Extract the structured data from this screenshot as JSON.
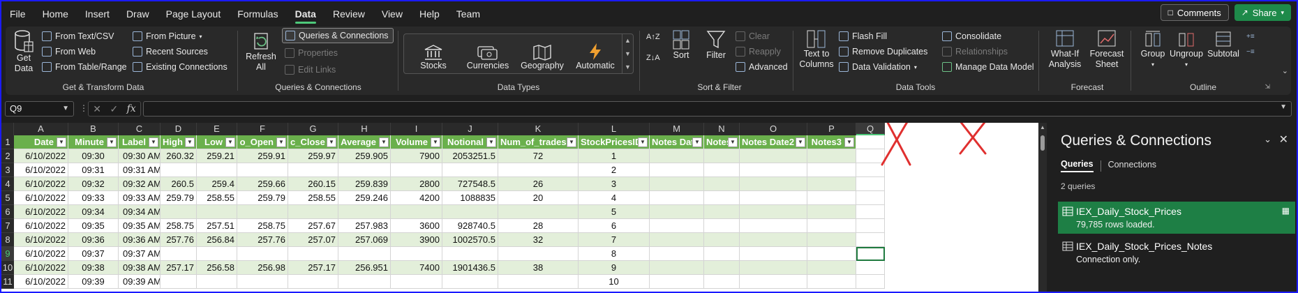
{
  "tabs": [
    "File",
    "Home",
    "Insert",
    "Draw",
    "Page Layout",
    "Formulas",
    "Data",
    "Review",
    "View",
    "Help",
    "Team"
  ],
  "active_tab": "Data",
  "top_buttons": {
    "comments": "Comments",
    "share": "Share"
  },
  "ribbon": {
    "get_transform": {
      "label": "Get & Transform Data",
      "get_data": "Get Data",
      "from_text_csv": "From Text/CSV",
      "from_web": "From Web",
      "from_table_range": "From Table/Range",
      "from_picture": "From Picture",
      "recent_sources": "Recent Sources",
      "existing_connections": "Existing Connections"
    },
    "queries_connections": {
      "label": "Queries & Connections",
      "refresh_all": "Refresh All",
      "queries_connections_btn": "Queries & Connections",
      "properties": "Properties",
      "edit_links": "Edit Links"
    },
    "data_types": {
      "label": "Data Types",
      "items": [
        "Stocks",
        "Currencies",
        "Geography",
        "Automatic"
      ]
    },
    "sort_filter": {
      "label": "Sort & Filter",
      "sort": "Sort",
      "filter": "Filter",
      "clear": "Clear",
      "reapply": "Reapply",
      "advanced": "Advanced"
    },
    "data_tools": {
      "label": "Data Tools",
      "text_to_columns": "Text to Columns",
      "flash_fill": "Flash Fill",
      "remove_duplicates": "Remove Duplicates",
      "data_validation": "Data Validation",
      "consolidate": "Consolidate",
      "relationships": "Relationships",
      "manage_data_model": "Manage Data Model"
    },
    "forecast": {
      "label": "Forecast",
      "what_if": "What-If Analysis",
      "forecast_sheet": "Forecast Sheet"
    },
    "outline": {
      "label": "Outline",
      "group": "Group",
      "ungroup": "Ungroup",
      "subtotal": "Subtotal"
    }
  },
  "formula_bar": {
    "name_box": "Q9",
    "formula": ""
  },
  "columns": [
    "A",
    "B",
    "C",
    "D",
    "E",
    "F",
    "G",
    "H",
    "I",
    "J",
    "K",
    "L",
    "M",
    "N",
    "O",
    "P",
    "Q"
  ],
  "selected_column": "Q",
  "selected_row": "9",
  "header_row": [
    "Date",
    "Minute",
    "Label",
    "High",
    "Low",
    "o_Open",
    "c_Close",
    "Average",
    "Volume",
    "Notional",
    "Num_of_trades",
    "StockPricesID",
    "Notes Date",
    "Notes",
    "Notes Date2",
    "Notes3"
  ],
  "rows": [
    [
      "6/10/2022",
      "09:30",
      "09:30 AM",
      "260.32",
      "259.21",
      "259.91",
      "259.97",
      "259.905",
      "7900",
      "2053251.5",
      "72",
      "1",
      "",
      "",
      "",
      ""
    ],
    [
      "6/10/2022",
      "09:31",
      "09:31 AM",
      "",
      "",
      "",
      "",
      "",
      "",
      "",
      "",
      "2",
      "",
      "",
      "",
      ""
    ],
    [
      "6/10/2022",
      "09:32",
      "09:32 AM",
      "260.5",
      "259.4",
      "259.66",
      "260.15",
      "259.839",
      "2800",
      "727548.5",
      "26",
      "3",
      "",
      "",
      "",
      ""
    ],
    [
      "6/10/2022",
      "09:33",
      "09:33 AM",
      "259.79",
      "258.55",
      "259.79",
      "258.55",
      "259.246",
      "4200",
      "1088835",
      "20",
      "4",
      "",
      "",
      "",
      ""
    ],
    [
      "6/10/2022",
      "09:34",
      "09:34 AM",
      "",
      "",
      "",
      "",
      "",
      "",
      "",
      "",
      "5",
      "",
      "",
      "",
      ""
    ],
    [
      "6/10/2022",
      "09:35",
      "09:35 AM",
      "258.75",
      "257.51",
      "258.75",
      "257.67",
      "257.983",
      "3600",
      "928740.5",
      "28",
      "6",
      "",
      "",
      "",
      ""
    ],
    [
      "6/10/2022",
      "09:36",
      "09:36 AM",
      "257.76",
      "256.84",
      "257.76",
      "257.07",
      "257.069",
      "3900",
      "1002570.5",
      "32",
      "7",
      "",
      "",
      "",
      ""
    ],
    [
      "6/10/2022",
      "09:37",
      "09:37 AM",
      "",
      "",
      "",
      "",
      "",
      "",
      "",
      "",
      "8",
      "",
      "",
      "",
      ""
    ],
    [
      "6/10/2022",
      "09:38",
      "09:38 AM",
      "257.17",
      "256.58",
      "256.98",
      "257.17",
      "256.951",
      "7400",
      "1901436.5",
      "38",
      "9",
      "",
      "",
      "",
      ""
    ],
    [
      "6/10/2022",
      "09:39",
      "09:39 AM",
      "",
      "",
      "",
      "",
      "",
      "",
      "",
      "",
      "10",
      "",
      "",
      "",
      ""
    ]
  ],
  "row_numbers": [
    "1",
    "2",
    "3",
    "4",
    "5",
    "6",
    "7",
    "8",
    "9",
    "10",
    "11"
  ],
  "pane": {
    "title": "Queries & Connections",
    "tabs": [
      "Queries",
      "Connections"
    ],
    "count": "2 queries",
    "queries": [
      {
        "name": "IEX_Daily_Stock_Prices",
        "status": "79,785 rows loaded."
      },
      {
        "name": "IEX_Daily_Stock_Prices_Notes",
        "status": "Connection only."
      }
    ]
  },
  "colors": {
    "accent": "#4ec97a",
    "table_header": "#6ab04c",
    "band": "#e3efda",
    "share": "#1e8a4a",
    "annotation_x": "#e0302f"
  }
}
